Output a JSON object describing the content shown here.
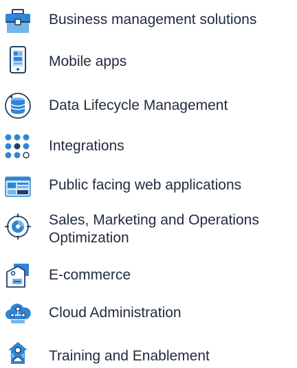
{
  "colors": {
    "blue": "#2f86d6",
    "light_blue": "#74b5ea",
    "navy": "#1f3f66",
    "text": "#1f2a3d"
  },
  "services": [
    {
      "label": "Business management solutions",
      "icon": "briefcase-icon"
    },
    {
      "label": "Mobile apps",
      "icon": "mobile-phone-icon"
    },
    {
      "label": "Data Lifecycle Management",
      "icon": "database-cycle-icon"
    },
    {
      "label": "Integrations",
      "icon": "dots-grid-icon"
    },
    {
      "label": "Public facing web applications",
      "icon": "browser-window-icon"
    },
    {
      "label": "Sales, Marketing and Operations Optimization",
      "icon": "target-chart-icon"
    },
    {
      "label": "E-commerce",
      "icon": "price-tag-icon"
    },
    {
      "label": "Cloud Administration",
      "icon": "cloud-network-icon"
    },
    {
      "label": "Training and Enablement",
      "icon": "training-people-icon"
    }
  ]
}
